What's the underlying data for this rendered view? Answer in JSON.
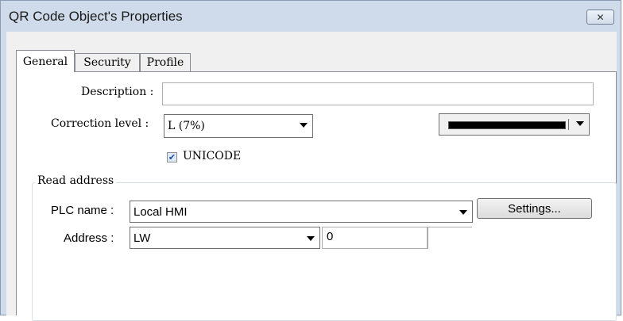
{
  "window": {
    "title": "QR Code Object's Properties"
  },
  "tabs": [
    {
      "label": "General",
      "active": true
    },
    {
      "label": "Security",
      "active": false
    },
    {
      "label": "Profile",
      "active": false
    }
  ],
  "general": {
    "description_label": "Description :",
    "description_value": "",
    "correction_label": "Correction level :",
    "correction_value": "L (7%)",
    "color_value": "#000000",
    "unicode_label": "UNICODE",
    "unicode_checked": true
  },
  "read_address": {
    "group_label": "Read address",
    "plc_label": "PLC name :",
    "plc_value": "Local HMI",
    "settings_label": "Settings...",
    "address_label": "Address :",
    "address_device": "LW",
    "address_value": "0"
  }
}
